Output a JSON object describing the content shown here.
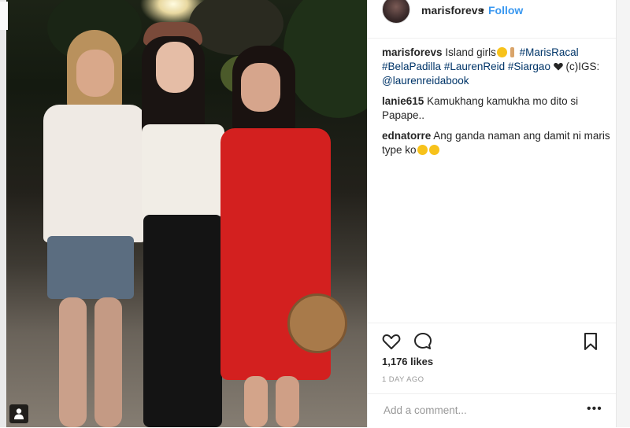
{
  "post": {
    "username": "marisforevs",
    "follow_label": "Follow",
    "separator": "•"
  },
  "caption": {
    "username": "marisforevs",
    "text_start": "Island girls",
    "tags": [
      "#MarisRacal",
      "#BelaPadilla",
      "#LaurenReid",
      "#Siargao"
    ],
    "text_after_heart": "(c)IGS:",
    "mention": "@laurenreidabook"
  },
  "comments": [
    {
      "username": "lanie615",
      "text": "Kamukhang kamukha mo dito si Papape.."
    },
    {
      "username": "ednatorre",
      "text": "Ang ganda naman ang damit ni maris type ko"
    }
  ],
  "likes": "1,176 likes",
  "date": "1 DAY AGO",
  "add_comment": {
    "placeholder": "Add a comment..."
  },
  "more_label": "•••",
  "icons": {
    "heart": "heart-outline-icon",
    "comment": "comment-bubble-icon",
    "save": "bookmark-icon",
    "photo_tag": "person-tag-icon"
  },
  "colors": {
    "link": "#3897f0",
    "hashtag": "#003569",
    "text": "#262626",
    "muted": "#999999"
  }
}
